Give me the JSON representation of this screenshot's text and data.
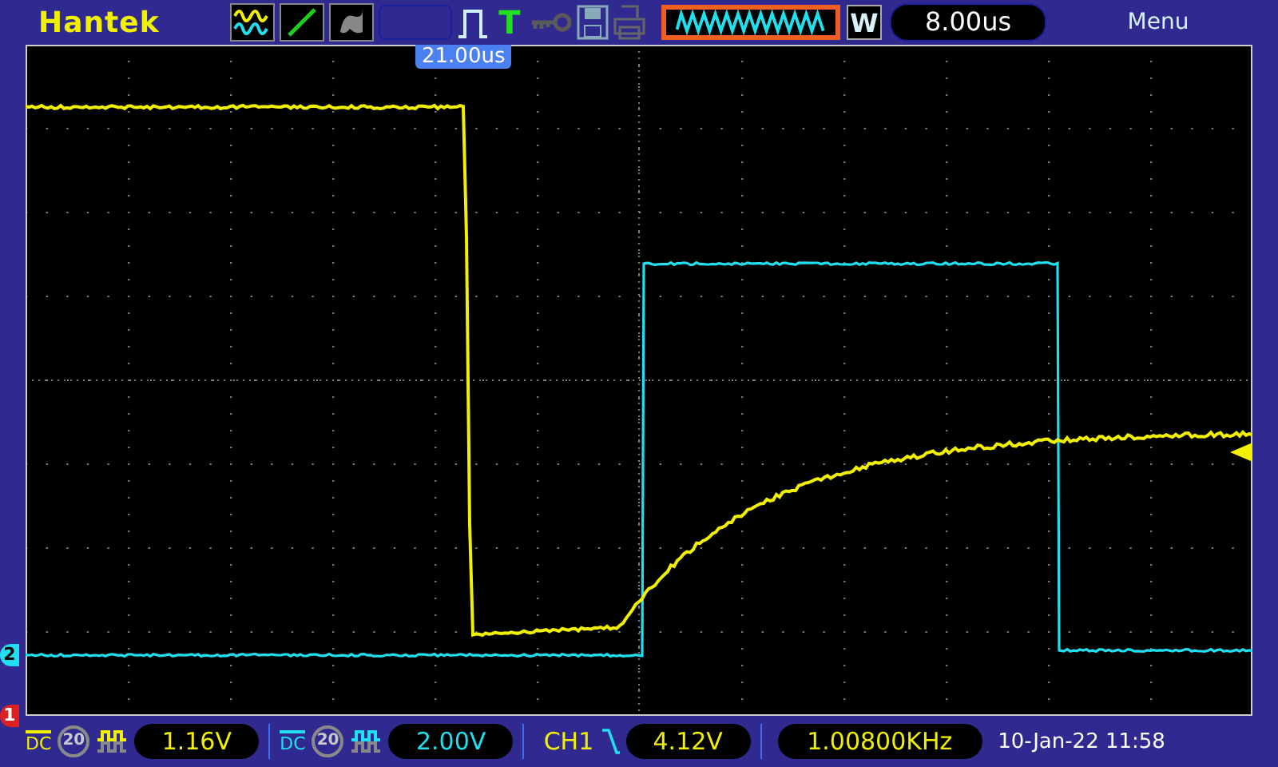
{
  "header": {
    "brand": "Hantek",
    "toolbar": [
      {
        "kind": "channels"
      },
      {
        "kind": "line"
      },
      {
        "kind": "persist"
      },
      {
        "kind": "blank"
      },
      {
        "kind": "pulse"
      },
      {
        "kind": "trigger",
        "label": "T"
      },
      {
        "kind": "key"
      },
      {
        "kind": "save"
      },
      {
        "kind": "print"
      }
    ],
    "waveform_button": "W",
    "timebase": "8.00us",
    "menu": "Menu"
  },
  "screen": {
    "trigger_position": "21.00us",
    "ch1_marker": "1",
    "ch2_marker": "2"
  },
  "footer": {
    "channels": [
      {
        "coupling": "DC",
        "bw_limit": "20",
        "scale": "1.16V",
        "color": "#f0f000"
      },
      {
        "coupling": "DC",
        "bw_limit": "20",
        "scale": "2.00V",
        "color": "#20e0f0"
      }
    ],
    "trigger": {
      "source": "CH1",
      "level": "4.12V"
    },
    "frequency": "1.00800KHz",
    "datetime": "10-Jan-22 11:58"
  }
}
